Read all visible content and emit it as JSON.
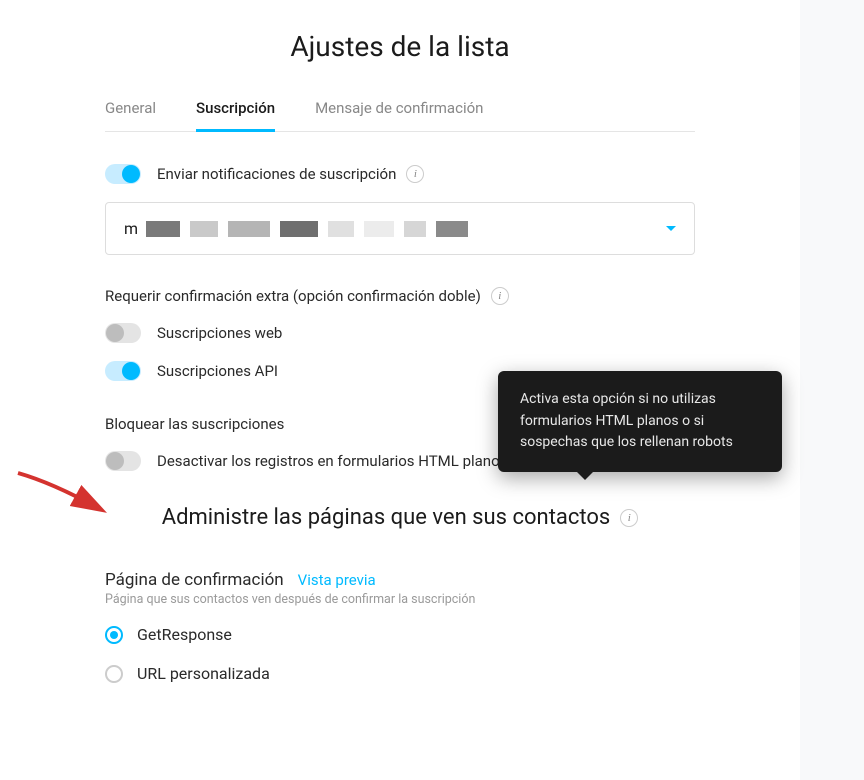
{
  "title": "Ajustes de la lista",
  "tabs": {
    "general": "General",
    "subscription": "Suscripción",
    "confirmation": "Mensaje de confirmación"
  },
  "notifications": {
    "label": "Enviar notificaciones de suscripción"
  },
  "select": {
    "prefix": "m"
  },
  "extraConfirm": {
    "heading": "Requerir confirmación extra (opción confirmación doble)",
    "web": "Suscripciones web",
    "api": "Suscripciones API"
  },
  "block": {
    "heading": "Bloquear las suscripciones",
    "disablePlain": "Desactivar los registros en formularios HTML plano"
  },
  "tooltip": {
    "text": "Activa esta opción si no utilizas formularios HTML planos o si sospechas que los rellenan robots"
  },
  "managePages": {
    "heading": "Administre las páginas que ven sus contactos"
  },
  "confirmPage": {
    "title": "Página de confirmación",
    "preview": "Vista previa",
    "desc": "Página que sus contactos ven después de confirmar la suscripción",
    "optGetResponse": "GetResponse",
    "optCustomUrl": "URL personalizada"
  }
}
